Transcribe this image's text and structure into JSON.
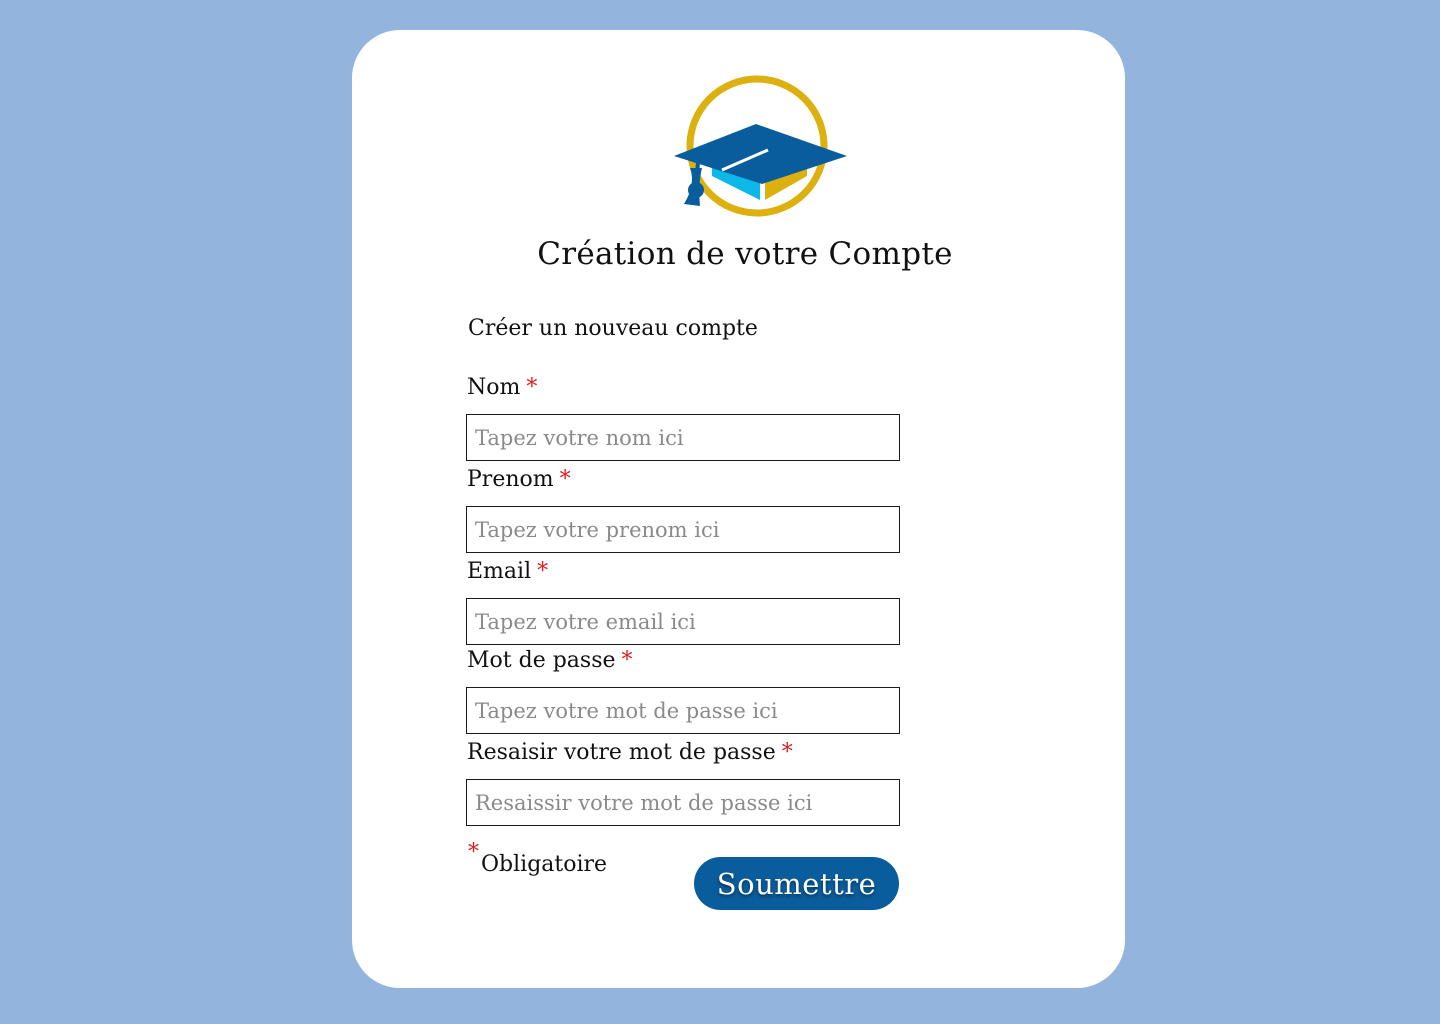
{
  "header": {
    "logo": "graduation-cap-logo",
    "title": "Création de votre Compte"
  },
  "form": {
    "subtitle": "Créer un nouveau compte",
    "required_marker": "*",
    "fields": [
      {
        "label": "Nom",
        "placeholder": "Tapez votre nom ici",
        "value": ""
      },
      {
        "label": "Prenom",
        "placeholder": "Tapez votre prenom ici",
        "value": ""
      },
      {
        "label": "Email",
        "placeholder": "Tapez votre email ici",
        "value": ""
      },
      {
        "label": "Mot de passe",
        "placeholder": "Tapez votre mot de passe ici",
        "value": ""
      },
      {
        "label": "Resaisir votre mot de passe",
        "placeholder": "Resaissir votre mot de passe ici",
        "value": ""
      }
    ],
    "required_note": "Obligatoire",
    "submit_label": "Soumettre"
  },
  "colors": {
    "background": "#93b4dc",
    "card": "#ffffff",
    "primary": "#0a5d9c",
    "required": "#d62020",
    "logo_gold": "#dcb00e",
    "logo_cyan": "#0bb8e8"
  }
}
